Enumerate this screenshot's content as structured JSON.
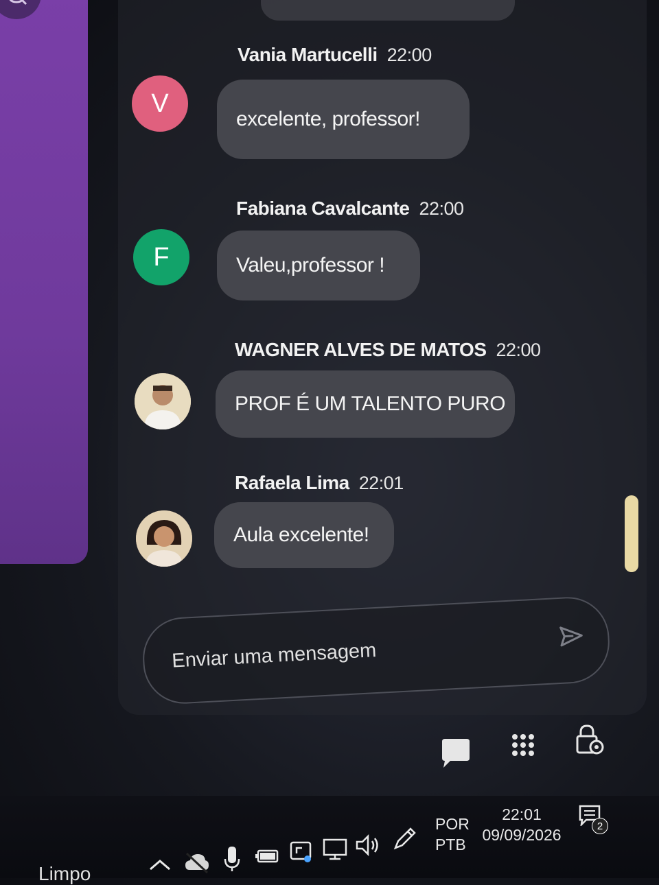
{
  "messages": [
    {
      "author": "Vania Martucelli",
      "time": "22:00",
      "text": "excelente, professor!",
      "avatar_letter": "V",
      "avatar_color": "#e0607e"
    },
    {
      "author": "Fabiana Cavalcante",
      "time": "22:00",
      "text": "Valeu,professor !",
      "avatar_letter": "F",
      "avatar_color": "#12a36a"
    },
    {
      "author": "WAGNER ALVES DE MATOS",
      "time": "22:00",
      "text": "PROF É UM TALENTO PURO",
      "avatar_letter": "",
      "avatar_color": "#d9c7a8"
    },
    {
      "author": "Rafaela Lima",
      "time": "22:01",
      "text": "Aula excelente!",
      "avatar_letter": "",
      "avatar_color": "#c9a88a"
    }
  ],
  "composer": {
    "placeholder": "Enviar uma mensagem"
  },
  "toolbar_icons": [
    "chat-icon",
    "apps-grid-icon",
    "lock-settings-icon"
  ],
  "taskbar": {
    "language_top": "POR",
    "language_bottom": "PTB",
    "time": "22:01",
    "date": "09/09/2026",
    "notification_count": "2",
    "partial_label": "Limpo"
  },
  "colors": {
    "left_panel": "#7a3fa8",
    "bubble": "#45464d",
    "scroll_thumb": "#e9d9a4"
  }
}
